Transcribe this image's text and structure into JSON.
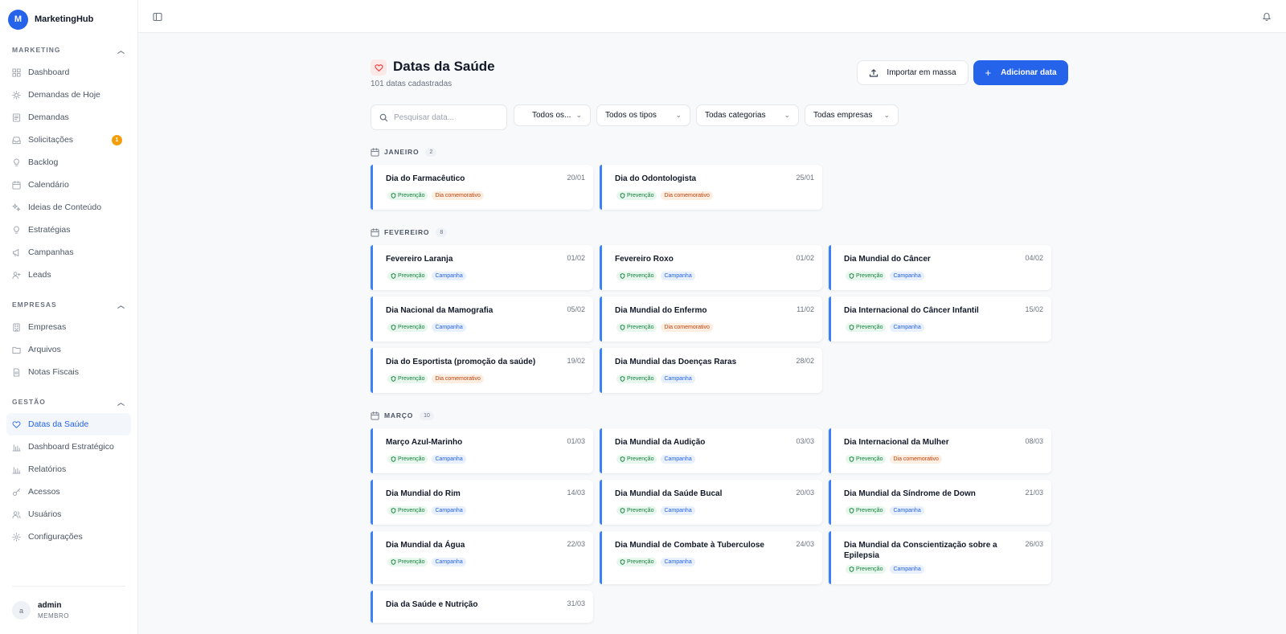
{
  "app": {
    "name": "MarketingHub",
    "logo_letter": "M"
  },
  "sidebar": {
    "groups": [
      {
        "label": "MARKETING",
        "items": [
          {
            "label": "Dashboard",
            "icon": "dashboard-icon"
          },
          {
            "label": "Demandas de Hoje",
            "icon": "sun-icon"
          },
          {
            "label": "Demandas",
            "icon": "list-icon"
          },
          {
            "label": "Solicitações",
            "icon": "inbox-icon",
            "badge": "1"
          },
          {
            "label": "Backlog",
            "icon": "lightbulb-icon"
          },
          {
            "label": "Calendário",
            "icon": "calendar-icon"
          },
          {
            "label": "Ideias de Conteúdo",
            "icon": "sparkles-icon"
          },
          {
            "label": "Estratégias",
            "icon": "lightbulb-icon"
          },
          {
            "label": "Campanhas",
            "icon": "megaphone-icon"
          },
          {
            "label": "Leads",
            "icon": "user-plus-icon"
          }
        ]
      },
      {
        "label": "EMPRESAS",
        "items": [
          {
            "label": "Empresas",
            "icon": "building-icon"
          },
          {
            "label": "Arquivos",
            "icon": "folder-icon"
          },
          {
            "label": "Notas Fiscais",
            "icon": "file-icon"
          }
        ]
      },
      {
        "label": "GESTÃO",
        "items": [
          {
            "label": "Datas da Saúde",
            "icon": "heart-icon",
            "active": true
          },
          {
            "label": "Dashboard Estratégico",
            "icon": "bar-chart-icon"
          },
          {
            "label": "Relatórios",
            "icon": "bar-chart-icon"
          },
          {
            "label": "Acessos",
            "icon": "key-icon"
          },
          {
            "label": "Usuários",
            "icon": "users-icon"
          },
          {
            "label": "Configurações",
            "icon": "gear-icon"
          }
        ]
      }
    ],
    "user": {
      "avatar": "a",
      "name": "admin",
      "role": "MEMBRO"
    }
  },
  "page": {
    "title": "Datas da Saúde",
    "subtitle": "101 datas cadastradas",
    "import_label": "Importar em massa",
    "add_label": "Adicionar data"
  },
  "filters": {
    "search_placeholder": "Pesquisar data...",
    "status": "Todos os...",
    "type": "Todos os tipos",
    "category": "Todas categorias",
    "company": "Todas empresas"
  },
  "tag_labels": {
    "prev": "Prevenção",
    "camp": "Campanha",
    "comm": "Dia comemorativo"
  },
  "months": [
    {
      "name": "JANEIRO",
      "count": "2"
    },
    {
      "name": "FEVEREIRO",
      "count": "8"
    },
    {
      "name": "MARÇO",
      "count": "10"
    }
  ],
  "cards": [
    {
      "title": "Dia do Farmacêutico",
      "date": "20/01",
      "tag": "comm"
    },
    {
      "title": "Dia do Odontologista",
      "date": "25/01",
      "tag": "comm"
    },
    {
      "title": "Fevereiro Laranja",
      "date": "01/02",
      "tag": "camp"
    },
    {
      "title": "Fevereiro Roxo",
      "date": "01/02",
      "tag": "camp"
    },
    {
      "title": "Dia Mundial do Câncer",
      "date": "04/02",
      "tag": "camp"
    },
    {
      "title": "Dia Nacional da Mamografia",
      "date": "05/02",
      "tag": "camp"
    },
    {
      "title": "Dia Mundial do Enfermo",
      "date": "11/02",
      "tag": "comm"
    },
    {
      "title": "Dia Internacional do Câncer Infantil",
      "date": "15/02",
      "tag": "camp"
    },
    {
      "title": "Dia do Esportista (promoção da saúde)",
      "date": "19/02",
      "tag": "comm"
    },
    {
      "title": "Dia Mundial das Doenças Raras",
      "date": "28/02",
      "tag": "camp"
    },
    {
      "title": "Março Azul-Marinho",
      "date": "01/03",
      "tag": "camp"
    },
    {
      "title": "Dia Mundial da Audição",
      "date": "03/03",
      "tag": "camp"
    },
    {
      "title": "Dia Internacional da Mulher",
      "date": "08/03",
      "tag": "comm"
    },
    {
      "title": "Dia Mundial do Rim",
      "date": "14/03",
      "tag": "camp"
    },
    {
      "title": "Dia Mundial da Saúde Bucal",
      "date": "20/03",
      "tag": "camp"
    },
    {
      "title": "Dia Mundial da Síndrome de Down",
      "date": "21/03",
      "tag": "camp"
    },
    {
      "title": "Dia Mundial da Água",
      "date": "22/03",
      "tag": "camp"
    },
    {
      "title": "Dia Mundial de Combate à Tuberculose",
      "date": "24/03",
      "tag": "camp"
    },
    {
      "title": "Dia Mundial da Conscientização sobre a Epilepsia",
      "date": "26/03",
      "tag": "camp"
    },
    {
      "title": "Dia da Saúde e Nutrição",
      "date": "31/03",
      "tag": "camp"
    }
  ]
}
